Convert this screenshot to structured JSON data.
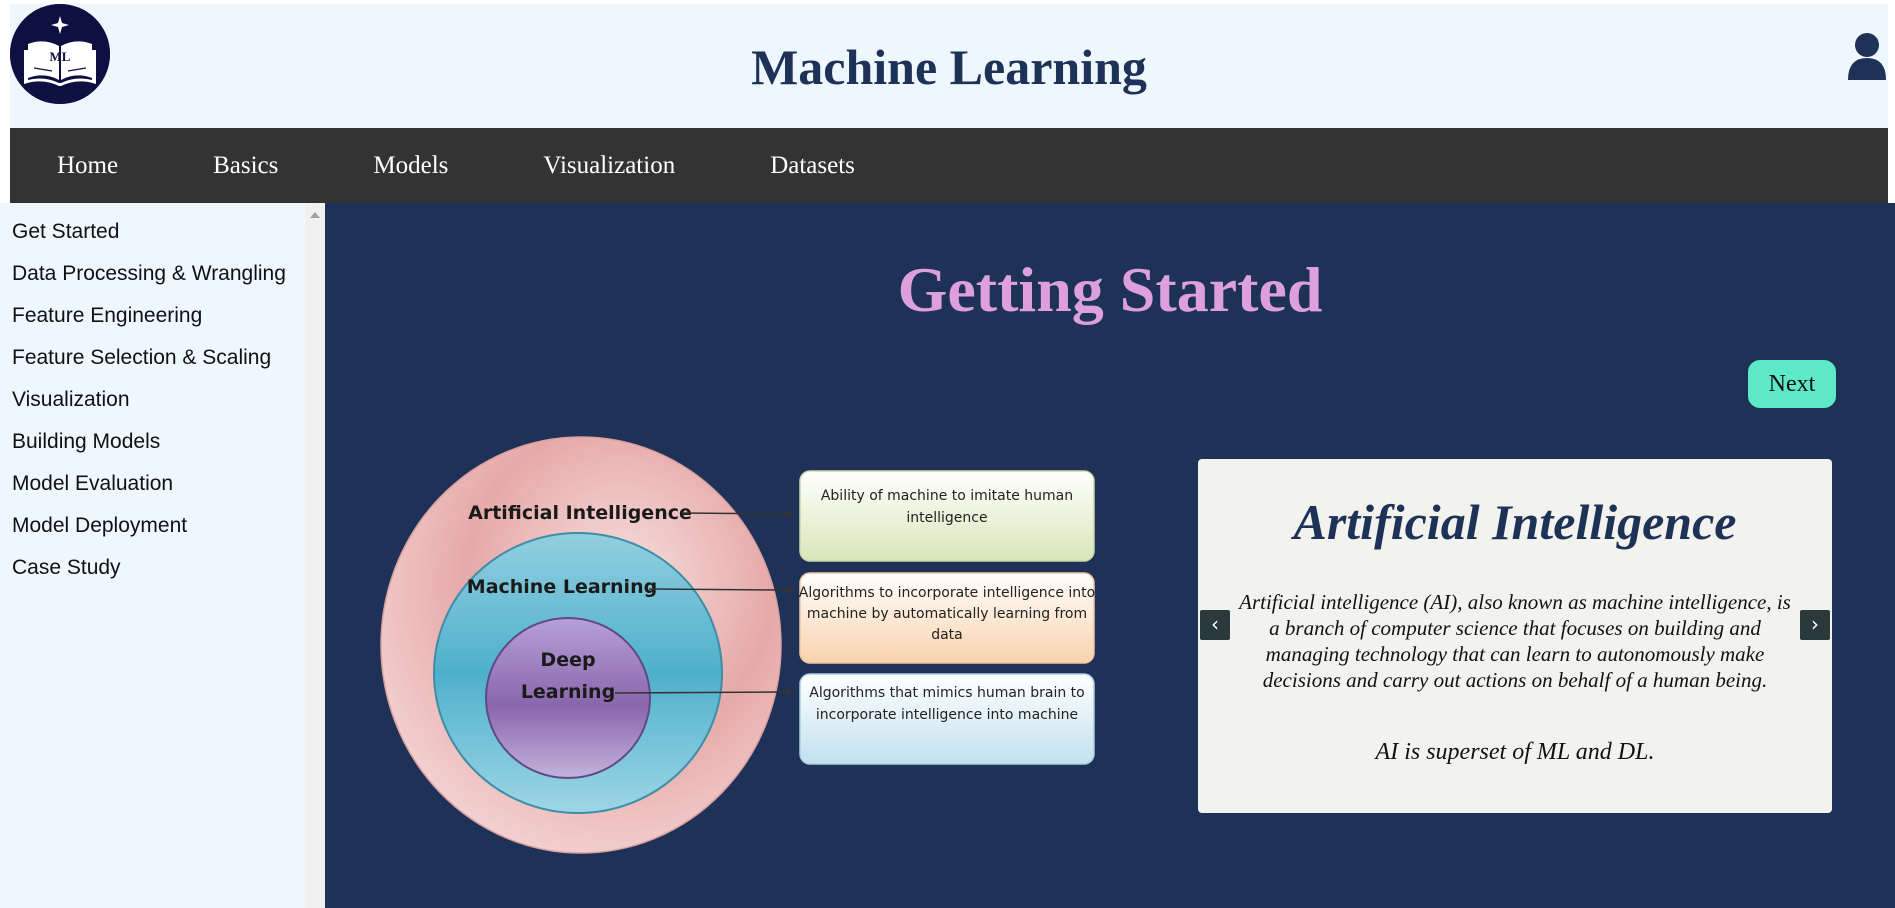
{
  "header": {
    "logo_text": "ML",
    "title": "Machine Learning"
  },
  "nav": {
    "items": [
      "Home",
      "Basics",
      "Models",
      "Visualization",
      "Datasets"
    ]
  },
  "sidebar": {
    "items": [
      "Get Started",
      "Data Processing & Wrangling",
      "Feature Engineering",
      "Feature Selection & Scaling",
      "Visualization",
      "Building Models",
      "Model Evaluation",
      "Model Deployment",
      "Case Study"
    ]
  },
  "main": {
    "title": "Getting Started",
    "next_label": "Next",
    "diagram": {
      "outer_label": "Artificial Intelligence",
      "middle_label": "Machine Learning",
      "inner_label_line1": "Deep",
      "inner_label_line2": "Learning",
      "box1_line1": "Ability of machine to imitate human",
      "box1_line2": "intelligence",
      "box2_line1": "Algorithms to incorporate intelligence into",
      "box2_line2": "machine by automatically learning from",
      "box2_line3": "data",
      "box3_line1": "Algorithms that mimics human brain to",
      "box3_line2": "incorporate intelligence into machine"
    },
    "card": {
      "title": "Artificial Intelligence",
      "body": "Artificial intelligence (AI), also known as machine intelligence, is a branch of computer science that focuses on building and managing technology that can learn to autonomously make decisions and carry out actions on behalf of a human being.",
      "note": "AI is superset of ML and DL.",
      "prev_label": "‹",
      "next_label": "›"
    }
  },
  "colors": {
    "header_bg": "#eef6fe",
    "nav_bg": "#333333",
    "main_bg": "#1e3257",
    "title_color": "#dda0dd",
    "next_button": "#5ee9c9",
    "card_bg": "#f2f2ee"
  },
  "icons": {
    "logo": "book-logo-icon",
    "user": "user-icon",
    "prev": "chevron-left-icon",
    "next": "chevron-right-icon",
    "scroll": "scroll-up-arrow-icon"
  }
}
